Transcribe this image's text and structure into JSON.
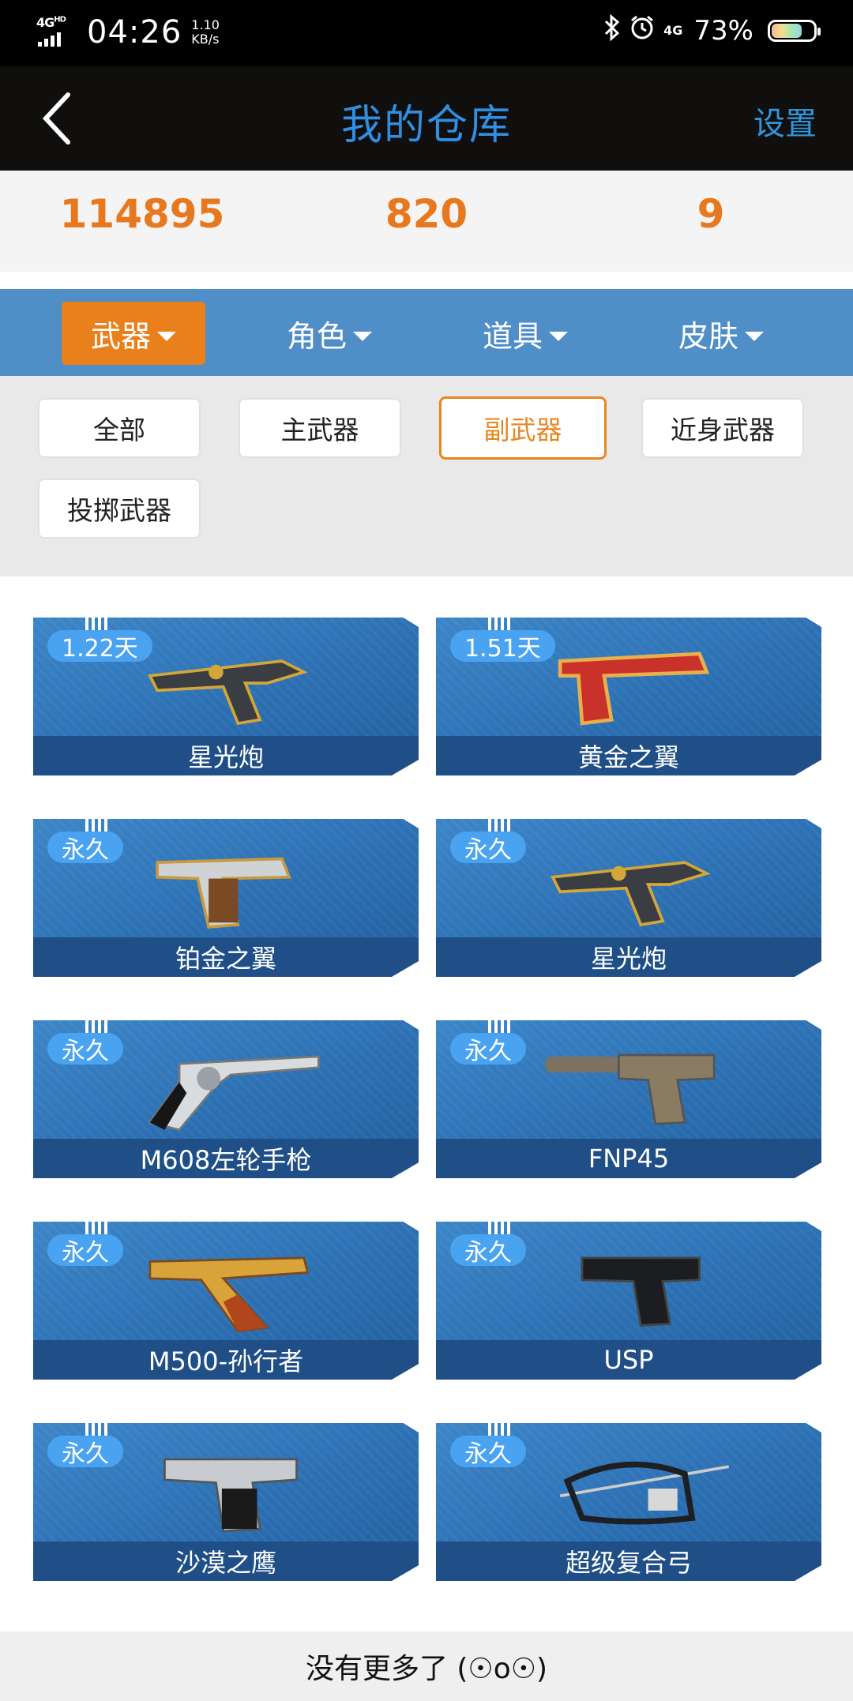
{
  "status_bar": {
    "network": "4G",
    "network_hd": "HD",
    "time": "04:26",
    "speed_value": "1.10",
    "speed_unit": "KB/s",
    "signal_label": "4G",
    "battery": "73%"
  },
  "header": {
    "title": "我的仓库",
    "settings_label": "设置"
  },
  "stats": [
    "114895",
    "820",
    "9"
  ],
  "categories": [
    {
      "label": "武器",
      "active": true
    },
    {
      "label": "角色",
      "active": false
    },
    {
      "label": "道具",
      "active": false
    },
    {
      "label": "皮肤",
      "active": false
    }
  ],
  "filters": [
    {
      "label": "全部",
      "active": false
    },
    {
      "label": "主武器",
      "active": false
    },
    {
      "label": "副武器",
      "active": true
    },
    {
      "label": "近身武器",
      "active": false
    },
    {
      "label": "投掷武器",
      "active": false
    }
  ],
  "items": [
    {
      "name": "星光炮",
      "duration": "1.22天",
      "icon": "pistol-starlight-icon"
    },
    {
      "name": "黄金之翼",
      "duration": "1.51天",
      "icon": "pistol-golden-wing-icon"
    },
    {
      "name": "铂金之翼",
      "duration": "永久",
      "icon": "pistol-platinum-wing-icon"
    },
    {
      "name": "星光炮",
      "duration": "永久",
      "icon": "pistol-starlight-icon"
    },
    {
      "name": "M608左轮手枪",
      "duration": "永久",
      "icon": "revolver-icon"
    },
    {
      "name": "FNP45",
      "duration": "永久",
      "icon": "pistol-suppressed-icon"
    },
    {
      "name": "M500-孙行者",
      "duration": "永久",
      "icon": "revolver-gold-icon"
    },
    {
      "name": "USP",
      "duration": "永久",
      "icon": "pistol-black-icon"
    },
    {
      "name": "沙漠之鹰",
      "duration": "永久",
      "icon": "pistol-desert-eagle-icon"
    },
    {
      "name": "超级复合弓",
      "duration": "永久",
      "icon": "compound-bow-icon"
    }
  ],
  "footer": {
    "text": "没有更多了 (☉o☉)"
  },
  "colors": {
    "accent_orange": "#e8781e",
    "title_blue": "#2f8fe3",
    "category_bar": "#4f8ec6",
    "card_blue": "#2b6fb2",
    "badge_blue": "#4aa3f0"
  }
}
